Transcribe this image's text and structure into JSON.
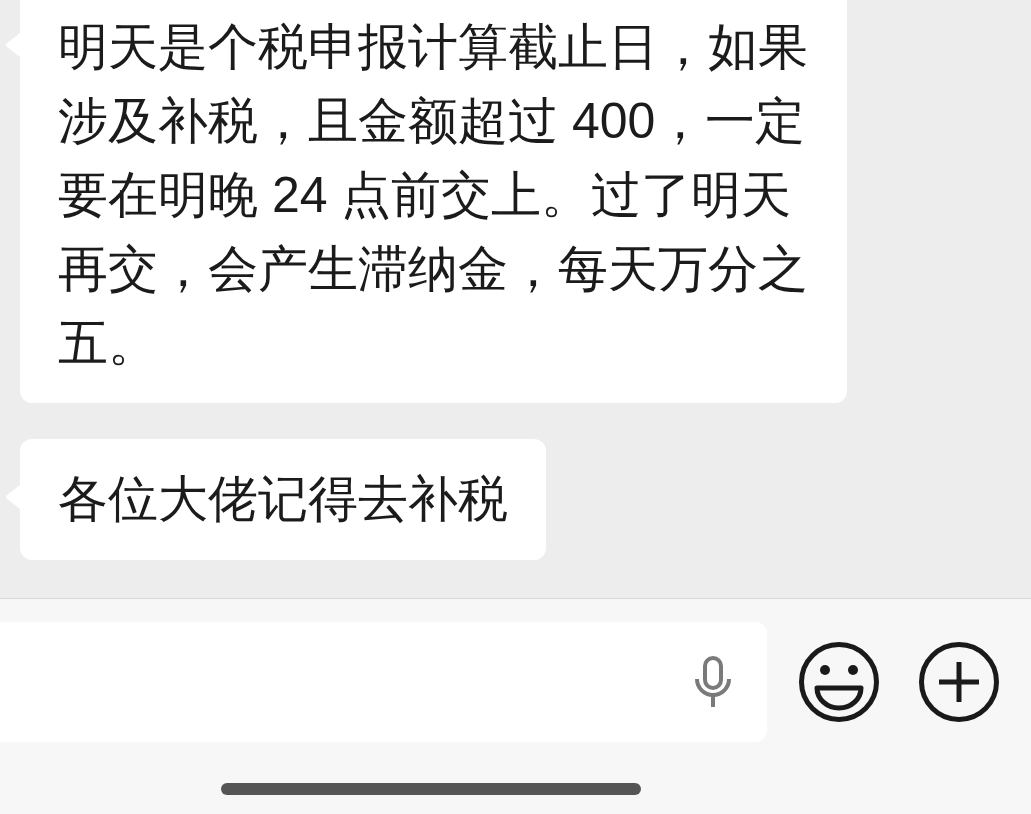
{
  "messages": [
    {
      "text": "明天是个税申报计算截止日，如果涉及补税，且金额超过 400，一定要在明晚 24 点前交上。过了明天再交，会产生滞纳金，每天万分之五。"
    },
    {
      "text": "各位大佬记得去补税"
    }
  ]
}
